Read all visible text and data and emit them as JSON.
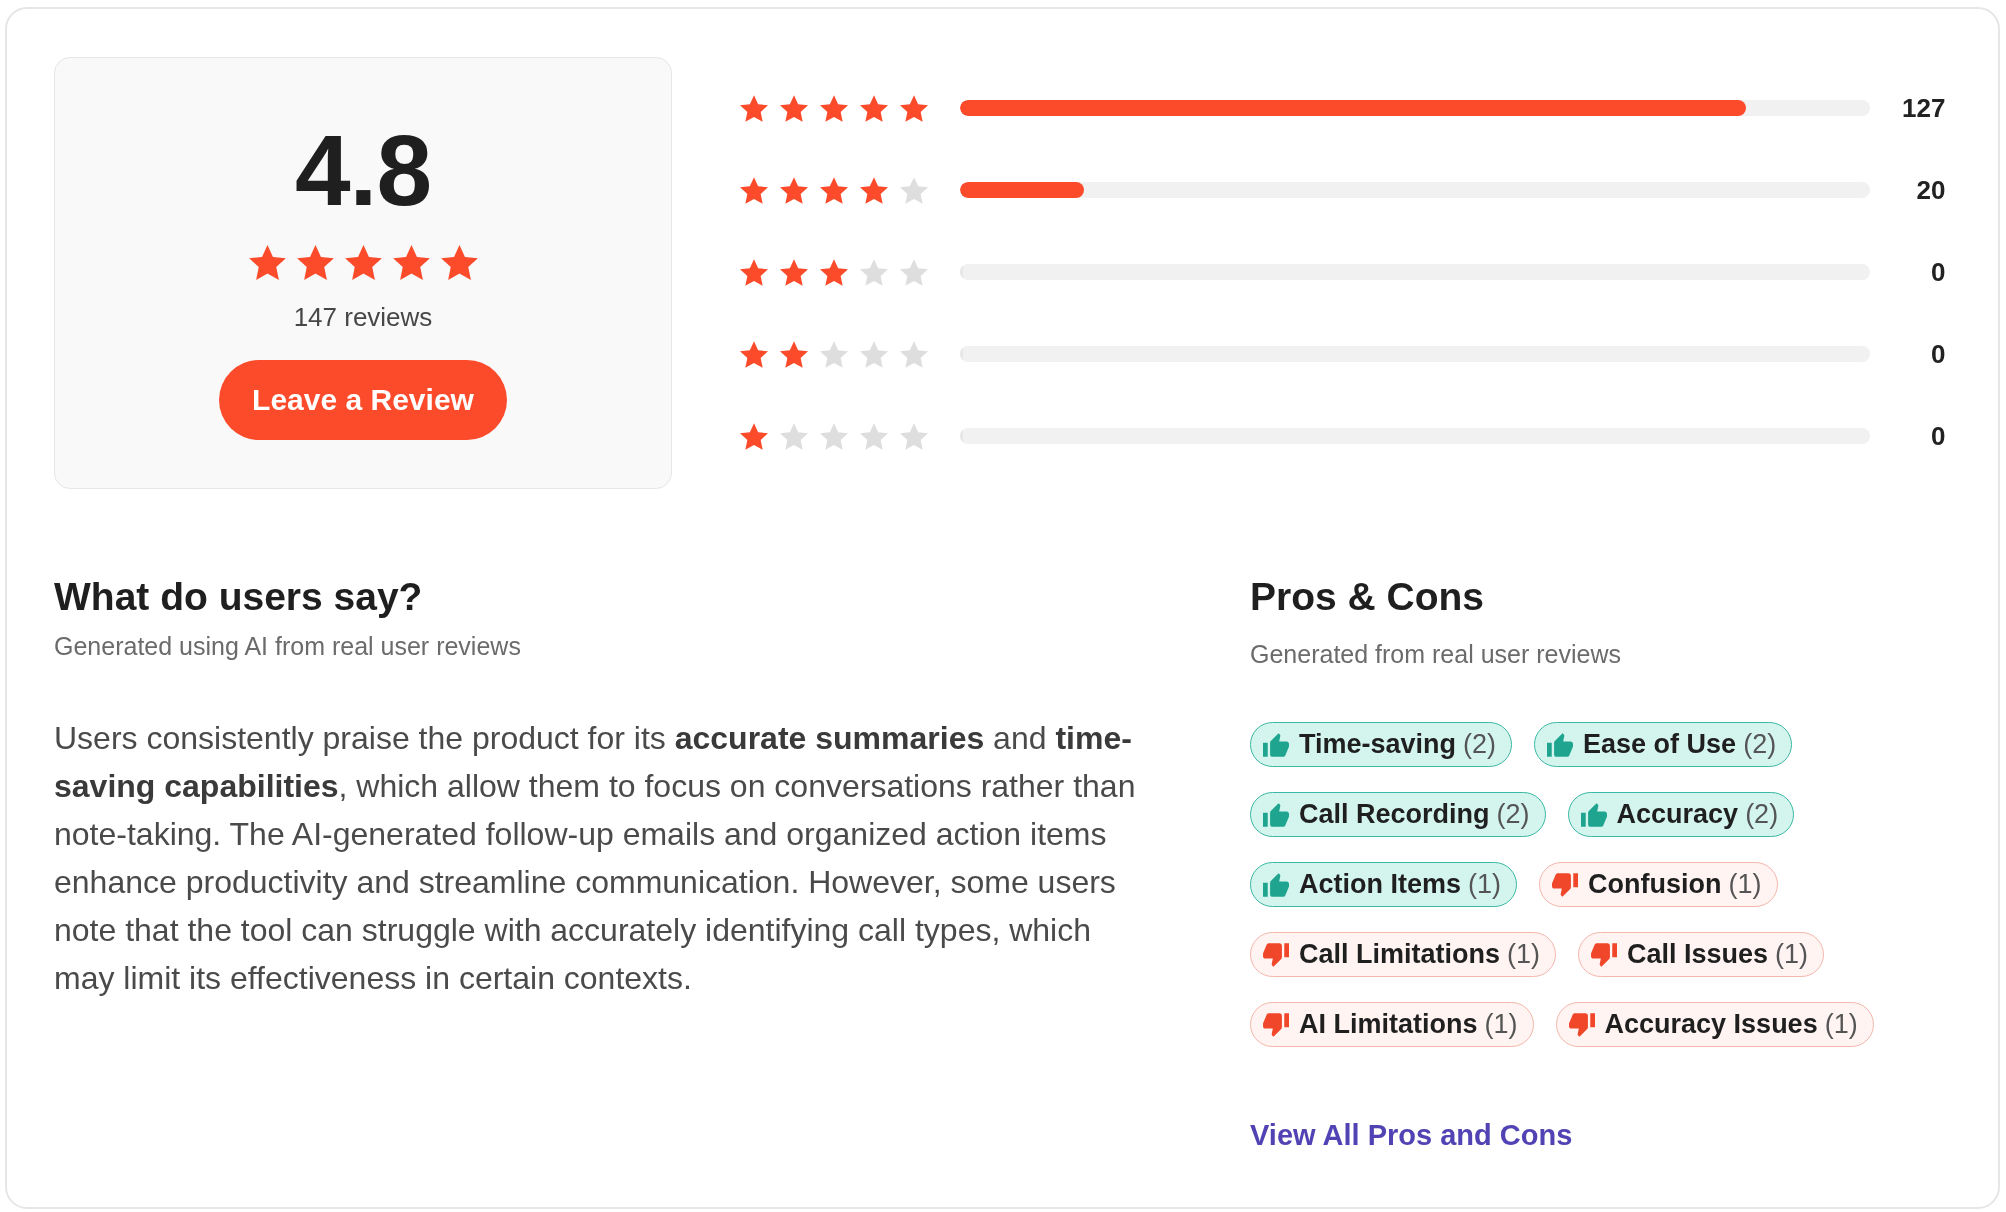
{
  "summary": {
    "rating": "4.8",
    "stars": 5,
    "review_count": "147 reviews",
    "button": "Leave a Review"
  },
  "distribution": [
    {
      "stars": 5,
      "level": 0.864,
      "count": "127"
    },
    {
      "stars": 4,
      "level": 0.136,
      "count": "20"
    },
    {
      "stars": 3,
      "level": 0,
      "count": "0"
    },
    {
      "stars": 2,
      "level": 0,
      "count": "0"
    },
    {
      "stars": 1,
      "level": 0,
      "count": "0"
    }
  ],
  "insights": {
    "title": "What do users say?",
    "subtitle": "Generated using AI from real user reviews",
    "text": "Users consistently praise the product for its **accurate summaries** and **time-saving capabilities**, which allow them to focus on conversations rather than note-taking. The AI-generated follow-up emails and organized action items enhance productivity and streamline communication. However, some users note that the tool can struggle with accurately identifying call types, which may limit its effectiveness in certain contexts."
  },
  "pros_cons": {
    "title": "Pros & Cons",
    "subtitle": "Generated from real user reviews",
    "tags": [
      {
        "kind": "pro",
        "label": "Time-saving",
        "count": "(2)"
      },
      {
        "kind": "pro",
        "label": "Ease of Use",
        "count": "(2)"
      },
      {
        "kind": "pro",
        "label": "Call Recording",
        "count": "(2)"
      },
      {
        "kind": "pro",
        "label": "Accuracy",
        "count": "(2)"
      },
      {
        "kind": "pro",
        "label": "Action Items",
        "count": "(1)"
      },
      {
        "kind": "con",
        "label": "Confusion",
        "count": "(1)"
      },
      {
        "kind": "con",
        "label": "Call Limitations",
        "count": "(1)"
      },
      {
        "kind": "con",
        "label": "Call Issues",
        "count": "(1)"
      },
      {
        "kind": "con",
        "label": "AI Limitations",
        "count": "(1)"
      },
      {
        "kind": "con",
        "label": "Accuracy Issues",
        "count": "(1)"
      }
    ],
    "link": "View All Pros and Cons"
  }
}
